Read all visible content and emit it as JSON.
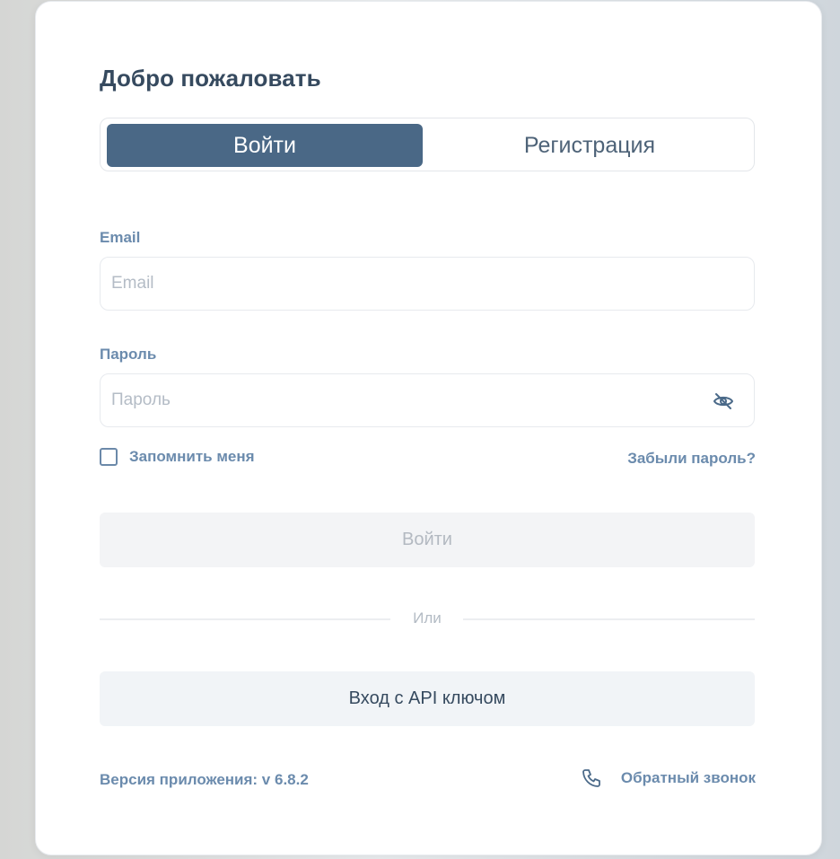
{
  "header": {
    "title": "Добро пожаловать"
  },
  "tabs": [
    {
      "label": "Войти",
      "active": true
    },
    {
      "label": "Регистрация",
      "active": false
    }
  ],
  "form": {
    "email_label": "Email",
    "email_placeholder": "Email",
    "email_value": "",
    "password_label": "Пароль",
    "password_placeholder": "Пароль",
    "password_value": "",
    "password_toggle_icon": "eye-off-icon",
    "remember_label": "Запомнить меня",
    "remember_checked": false,
    "forgot_label": "Забыли пароль?",
    "submit_label": "Войти"
  },
  "divider": {
    "label": "Или"
  },
  "api_login": {
    "label": "Вход с API ключом"
  },
  "footer": {
    "version": "Версия приложения: v 6.8.2",
    "callback_icon": "phone-icon",
    "callback_label": "Обратный звонок"
  },
  "colors": {
    "accent": "#4a6886",
    "label": "#6b8bad",
    "title": "#364a5f",
    "disabled_button_bg": "#f3f4f6",
    "secondary_button_bg": "#f1f4f7"
  }
}
